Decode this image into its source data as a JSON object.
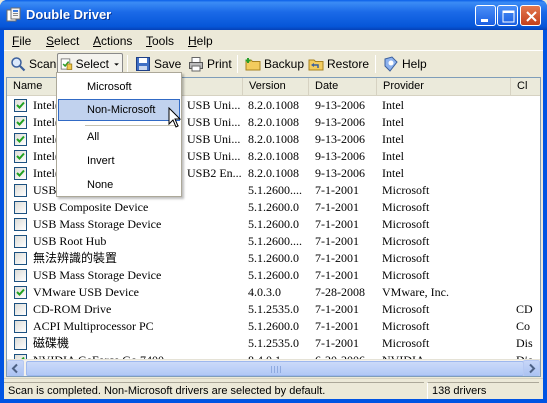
{
  "window": {
    "title": "Double Driver"
  },
  "menubar": {
    "items": [
      {
        "label": "File",
        "ul": "F",
        "rest": "ile"
      },
      {
        "label": "Select",
        "ul": "S",
        "rest": "elect"
      },
      {
        "label": "Actions",
        "ul": "A",
        "rest": "ctions"
      },
      {
        "label": "Tools",
        "ul": "T",
        "rest": "ools"
      },
      {
        "label": "Help",
        "ul": "H",
        "rest": "elp"
      }
    ]
  },
  "toolbar": {
    "scan": "Scan",
    "select": "Select",
    "save": "Save",
    "print": "Print",
    "backup": "Backup",
    "restore": "Restore",
    "help": "Help"
  },
  "list": {
    "columns": [
      "Name",
      "Version",
      "Date",
      "Provider",
      "Cl"
    ],
    "rows": [
      {
        "checked": true,
        "name": "Intel(R) ... USB Uni...",
        "name_left": "Intel(",
        "name_right": "USB Uni...",
        "version": "8.2.0.1008",
        "date": "9-13-2006",
        "provider": "Intel",
        "cls": ""
      },
      {
        "checked": true,
        "name_left": "Intel(",
        "name_right": "USB Uni...",
        "version": "8.2.0.1008",
        "date": "9-13-2006",
        "provider": "Intel",
        "cls": ""
      },
      {
        "checked": true,
        "name_left": "Intel(",
        "name_right": "USB Uni...",
        "version": "8.2.0.1008",
        "date": "9-13-2006",
        "provider": "Intel",
        "cls": ""
      },
      {
        "checked": true,
        "name_left": "Intel(",
        "name_right": "USB Uni...",
        "version": "8.2.0.1008",
        "date": "9-13-2006",
        "provider": "Intel",
        "cls": ""
      },
      {
        "checked": true,
        "name_left": "Intel(",
        "name_right": "USB2 En...",
        "version": "8.2.0.1008",
        "date": "9-13-2006",
        "provider": "Intel",
        "cls": ""
      },
      {
        "checked": false,
        "name_left": "USB",
        "name_right": "",
        "version": "5.1.2600....",
        "date": "7-1-2001",
        "provider": "Microsoft",
        "cls": ""
      },
      {
        "checked": false,
        "name_left": "USB Composite Device",
        "name_right": "",
        "version": "5.1.2600.0",
        "date": "7-1-2001",
        "provider": "Microsoft",
        "cls": ""
      },
      {
        "checked": false,
        "name_left": "USB Mass Storage Device",
        "name_right": "",
        "version": "5.1.2600.0",
        "date": "7-1-2001",
        "provider": "Microsoft",
        "cls": ""
      },
      {
        "checked": false,
        "name_left": "USB Root Hub",
        "name_right": "",
        "version": "5.1.2600....",
        "date": "7-1-2001",
        "provider": "Microsoft",
        "cls": ""
      },
      {
        "checked": false,
        "name_left": "無法辨識的裝置",
        "name_right": "",
        "version": "5.1.2600.0",
        "date": "7-1-2001",
        "provider": "Microsoft",
        "cls": ""
      },
      {
        "checked": false,
        "name_left": "USB Mass Storage Device",
        "name_right": "",
        "version": "5.1.2600.0",
        "date": "7-1-2001",
        "provider": "Microsoft",
        "cls": ""
      },
      {
        "checked": true,
        "name_left": "VMware USB Device",
        "name_right": "",
        "version": "4.0.3.0",
        "date": "7-28-2008",
        "provider": "VMware, Inc.",
        "cls": ""
      },
      {
        "checked": false,
        "name_left": "CD-ROM Drive",
        "name_right": "",
        "version": "5.1.2535.0",
        "date": "7-1-2001",
        "provider": "Microsoft",
        "cls": "CD"
      },
      {
        "checked": false,
        "name_left": "ACPI Multiprocessor PC",
        "name_right": "",
        "version": "5.1.2600.0",
        "date": "7-1-2001",
        "provider": "Microsoft",
        "cls": "Co"
      },
      {
        "checked": false,
        "name_left": "磁碟機",
        "name_right": "",
        "version": "5.1.2535.0",
        "date": "7-1-2001",
        "provider": "Microsoft",
        "cls": "Dis"
      },
      {
        "checked": true,
        "name_left": "NVIDIA GeForce Go 7400",
        "name_right": "",
        "version": "8.4.0.1",
        "date": "6-20-2006",
        "provider": "NVIDIA",
        "cls": "Dis"
      }
    ]
  },
  "select_menu": {
    "items": [
      "Microsoft",
      "Non-Microsoft",
      "All",
      "Invert",
      "None"
    ],
    "hovered": "Non-Microsoft"
  },
  "status": {
    "message": "Scan is completed. Non-Microsoft drivers are selected by default.",
    "count": "138 drivers"
  },
  "colors": {
    "title_bar": "#0054e3",
    "close_button": "#c4401b",
    "menu_highlight": "#c1d2ee",
    "check_green": "#21a121"
  }
}
